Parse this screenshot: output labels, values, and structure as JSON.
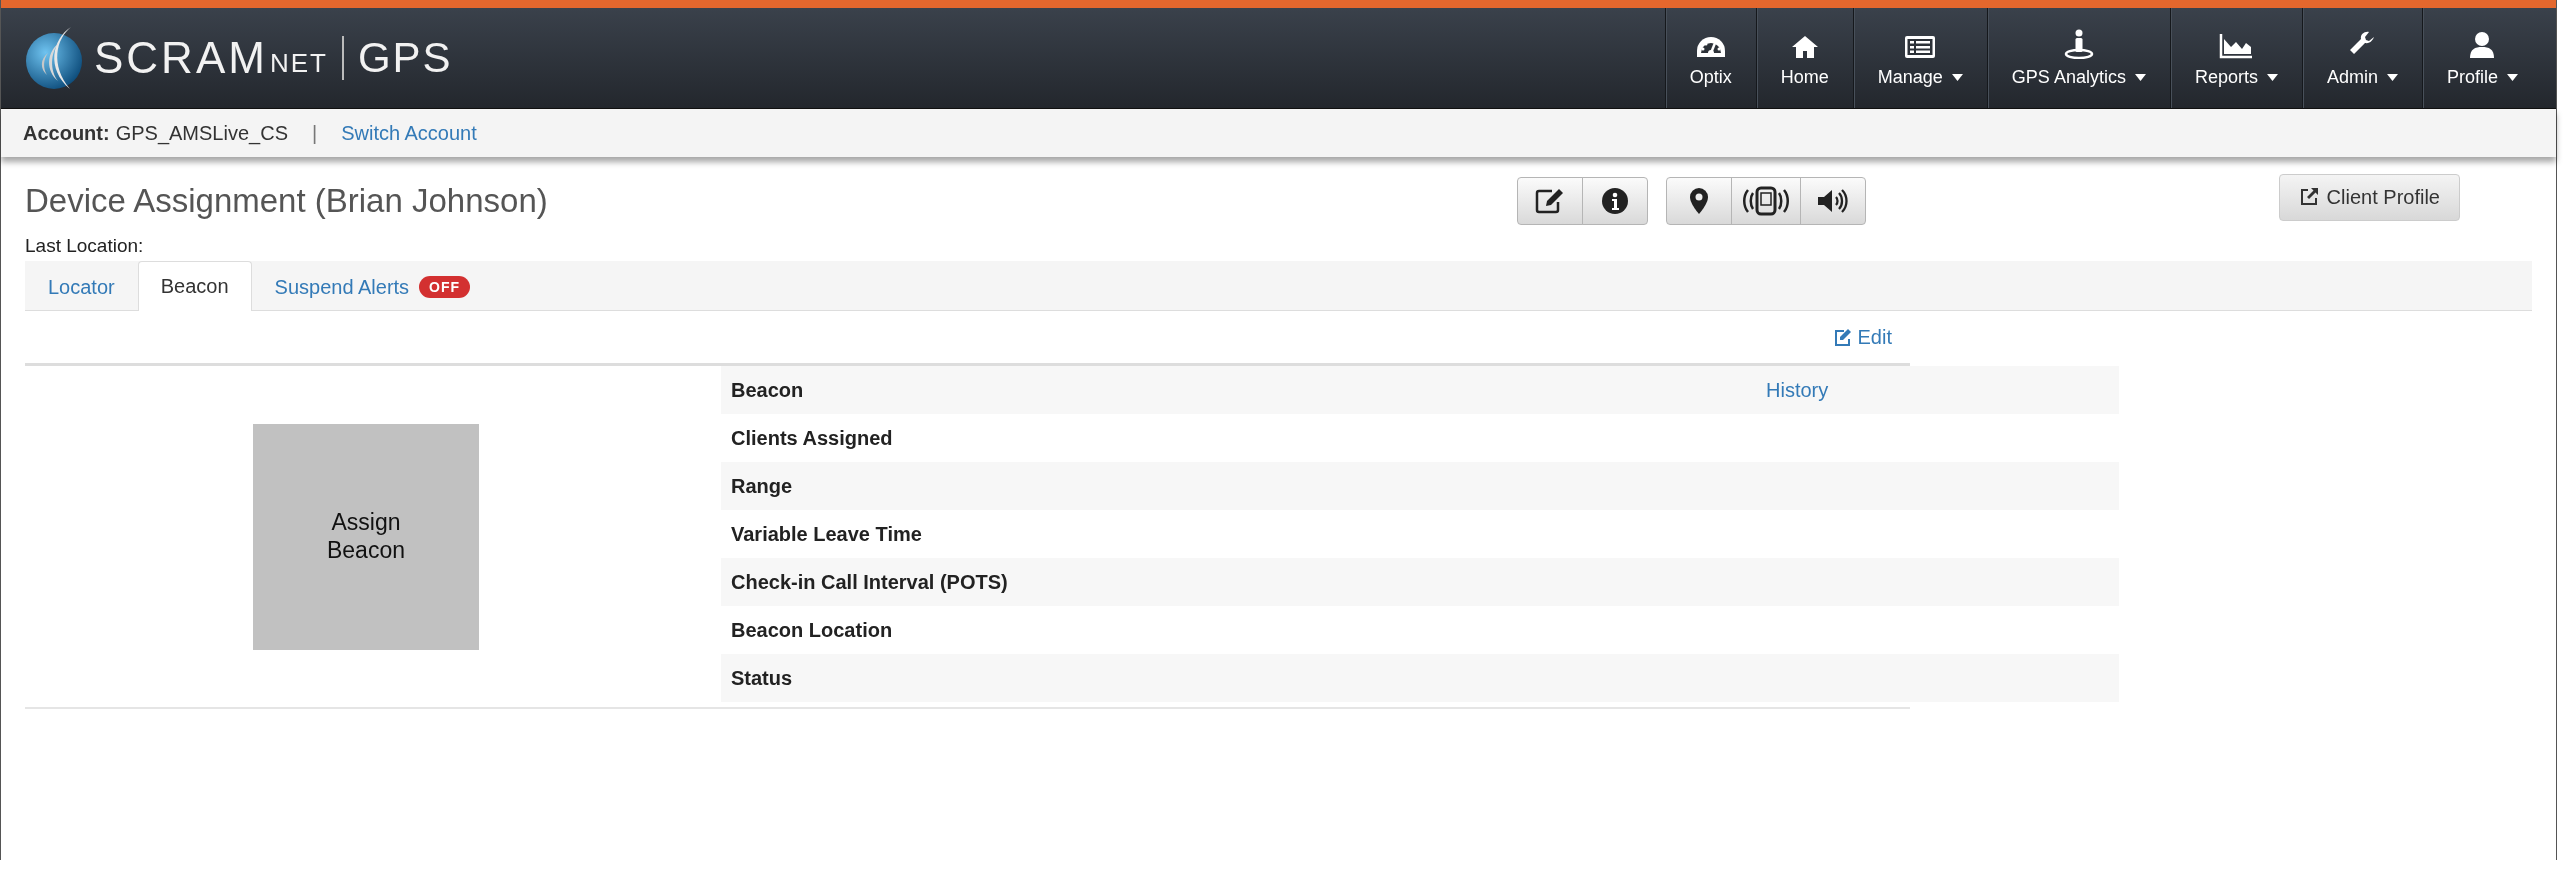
{
  "logo": {
    "brand": "SCRAM",
    "suffix": "NET",
    "product": "GPS"
  },
  "nav": [
    {
      "label": "Optix",
      "dropdown": false
    },
    {
      "label": "Home",
      "dropdown": false
    },
    {
      "label": "Manage",
      "dropdown": true
    },
    {
      "label": "GPS Analytics",
      "dropdown": true
    },
    {
      "label": "Reports",
      "dropdown": true
    },
    {
      "label": "Admin",
      "dropdown": true
    },
    {
      "label": "Profile",
      "dropdown": true
    }
  ],
  "account": {
    "label": "Account:",
    "value": "GPS_AMSLive_CS",
    "separator": "|",
    "switch_link": "Switch Account"
  },
  "page_title": "Device Assignment (Brian Johnson)",
  "client_profile_button": "Client Profile",
  "last_location_label": "Last Location:",
  "tabs": [
    {
      "label": "Locator",
      "selected": false
    },
    {
      "label": "Beacon",
      "selected": true
    },
    {
      "label": "Suspend Alerts",
      "selected": false,
      "badge": "OFF"
    }
  ],
  "edit_link": "Edit",
  "assign_beacon": "Assign Beacon",
  "beacon_rows": [
    {
      "label": "Beacon",
      "link": "History"
    },
    {
      "label": "Clients Assigned"
    },
    {
      "label": "Range"
    },
    {
      "label": "Variable Leave Time"
    },
    {
      "label": "Check-in Call Interval (POTS)"
    },
    {
      "label": "Beacon Location"
    },
    {
      "label": "Status"
    }
  ]
}
